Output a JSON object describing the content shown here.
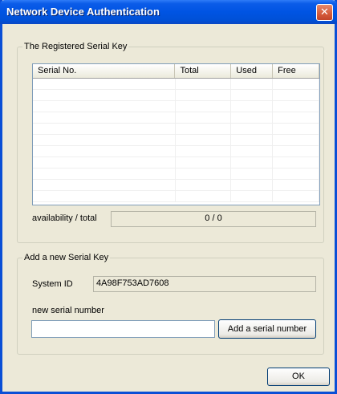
{
  "window": {
    "title": "Network Device Authentication",
    "close_glyph": "✕"
  },
  "registered_group": {
    "legend": "The Registered Serial Key",
    "columns": [
      "Serial No.",
      "Total",
      "Used",
      "Free"
    ],
    "rows": [],
    "availability_label": "availability / total",
    "availability_value": "0 / 0"
  },
  "new_key_group": {
    "legend": "Add a new Serial Key",
    "system_id_label": "System ID",
    "system_id_value": "4A98F753AD7608",
    "new_serial_label": "new serial number",
    "new_serial_value": "",
    "add_button": "Add a serial number"
  },
  "ok_button": "OK",
  "colors": {
    "titlebar": "#0054e3",
    "face": "#ece9d8",
    "border": "#0a4fd6"
  }
}
